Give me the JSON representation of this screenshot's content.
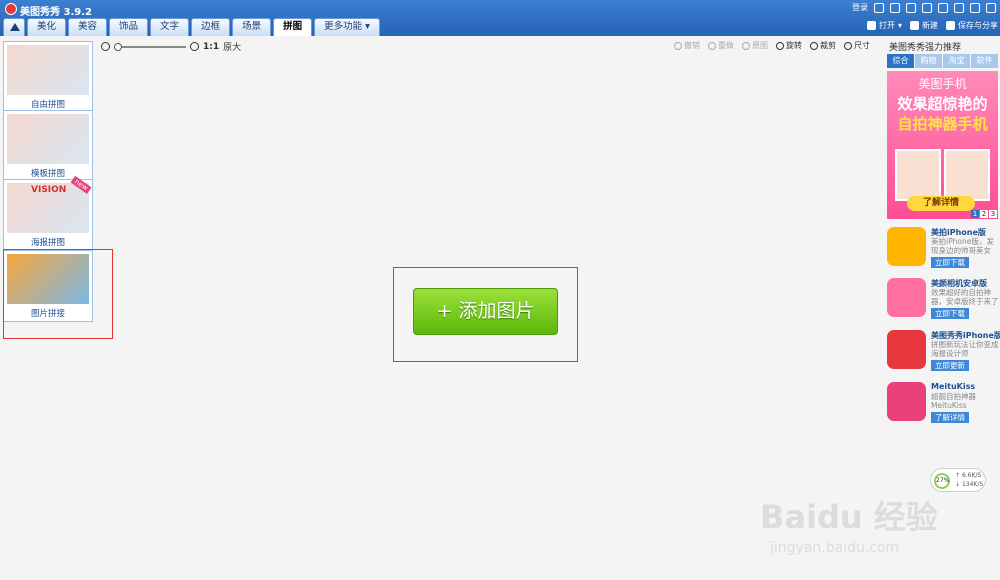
{
  "app": {
    "title": "美图秀秀 3.9.2"
  },
  "tabs": [
    {
      "label": "美化"
    },
    {
      "label": "美容"
    },
    {
      "label": "饰品"
    },
    {
      "label": "文字"
    },
    {
      "label": "边框"
    },
    {
      "label": "场景"
    },
    {
      "label": "拼图"
    },
    {
      "label": "更多功能"
    }
  ],
  "top_right": {
    "login": "登录"
  },
  "right_actions": {
    "open": "打开",
    "new": "新建",
    "save_share": "保存与分享"
  },
  "left_panel": {
    "items": [
      {
        "label": "自由拼图"
      },
      {
        "label": "模板拼图"
      },
      {
        "label": "海报拼图",
        "thumb_text": "VISION",
        "badge": "new"
      },
      {
        "label": "图片拼接"
      }
    ]
  },
  "toolbar": {
    "zoom_ratio": "1:1",
    "zoom_original": "原大",
    "actions": [
      {
        "label": "撤销",
        "enabled": false
      },
      {
        "label": "重做",
        "enabled": false
      },
      {
        "label": "原图",
        "enabled": false
      },
      {
        "label": "旋转",
        "enabled": true
      },
      {
        "label": "裁剪",
        "enabled": true
      },
      {
        "label": "尺寸",
        "enabled": true
      }
    ]
  },
  "canvas": {
    "add_button": "+ 添加图片"
  },
  "right_panel": {
    "title": "美图秀秀强力推荐",
    "tabs": [
      "综合",
      "购物",
      "淘宝",
      "软件"
    ],
    "banner": {
      "line1": "美图手机",
      "line2": "效果超惊艳的",
      "line3": "自拍神器手机",
      "cta": "了解详情",
      "pages": [
        "1",
        "2",
        "3"
      ]
    },
    "promos": [
      {
        "title": "美拍iPhone版",
        "desc": "美拍iPhone版，发现身边的帅哥美女",
        "button": "立即下载",
        "icon_color": "#ffb400",
        "icon": "meipai-icon"
      },
      {
        "title": "美颜相机安卓版",
        "desc": "效果超好的自拍神器，安卓版终于来了",
        "button": "立即下载",
        "icon_color": "#ff6fa0",
        "icon": "camera-icon"
      },
      {
        "title": "美图秀秀iPhone版",
        "desc": "拼图新玩法让你变成海报设计师",
        "button": "立即更新",
        "icon_color": "#e8383d",
        "icon": "xiu-icon"
      },
      {
        "title": "MeituKiss",
        "desc": "超靓自拍神器 MeituKiss",
        "button": "了解详情",
        "icon_color": "#e8407a",
        "icon": "meitu-kiss-icon"
      }
    ]
  },
  "net_widget": {
    "percent": "27%",
    "up": "6.6K/S",
    "down": "134K/S"
  },
  "watermark": {
    "text": "Baidu 经验",
    "url": "jingyan.baidu.com"
  }
}
